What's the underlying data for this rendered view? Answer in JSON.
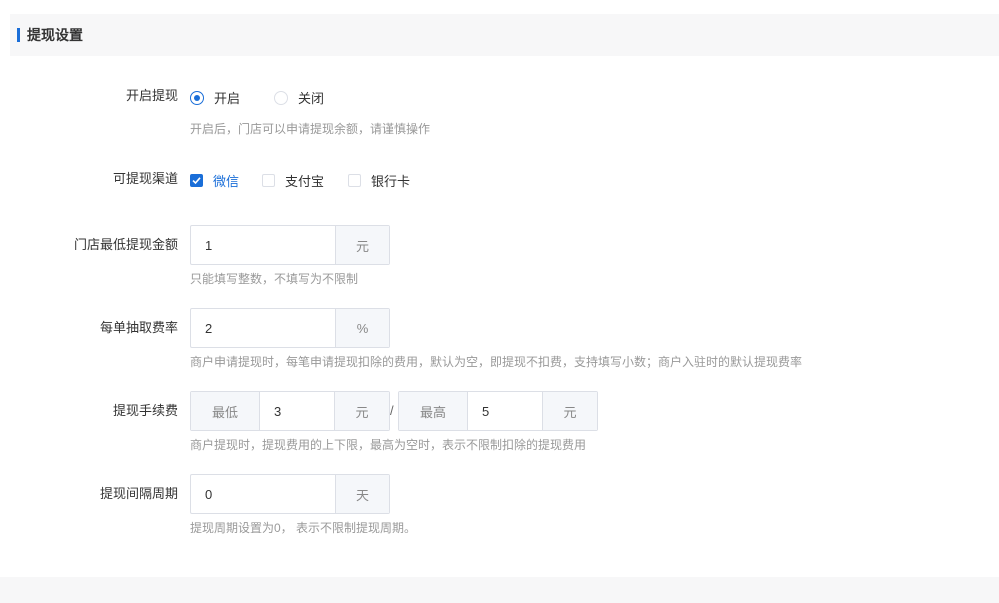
{
  "section": {
    "title": "提现设置"
  },
  "enable": {
    "label": "开启提现",
    "options": [
      "开启",
      "关闭"
    ],
    "selected": "开启",
    "hint": "开启后，门店可以申请提现余额，请谨慎操作"
  },
  "channels": {
    "label": "可提现渠道",
    "options": [
      {
        "label": "微信",
        "checked": true
      },
      {
        "label": "支付宝",
        "checked": false
      },
      {
        "label": "银行卡",
        "checked": false
      }
    ]
  },
  "min_amount": {
    "label": "门店最低提现金额",
    "value": "1",
    "unit": "元",
    "hint": "只能填写整数，不填写为不限制"
  },
  "fee_rate": {
    "label": "每单抽取费率",
    "value": "2",
    "unit": "%",
    "hint": "商户申请提现时，每笔申请提现扣除的费用，默认为空，即提现不扣费，支持填写小数；商户入驻时的默认提现费率"
  },
  "fee": {
    "label": "提现手续费",
    "min_prefix": "最低",
    "min_value": "3",
    "min_unit": "元",
    "separator": "/",
    "max_prefix": "最高",
    "max_value": "5",
    "max_unit": "元",
    "hint": "商户提现时，提现费用的上下限，最高为空时，表示不限制扣除的提现费用"
  },
  "interval": {
    "label": "提现间隔周期",
    "value": "0",
    "unit": "天",
    "hint": "提现周期设置为0， 表示不限制提现周期。"
  },
  "colors": {
    "accent": "#1a6ed8",
    "hint": "#999999",
    "addon_bg": "#f5f7fa",
    "border": "#dcdfe6"
  }
}
